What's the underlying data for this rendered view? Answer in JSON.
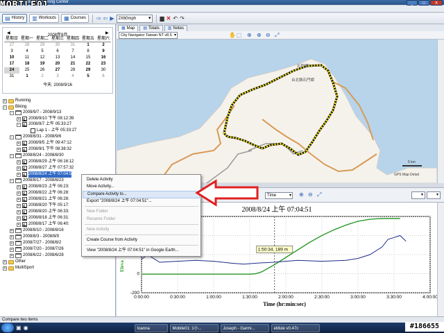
{
  "window": {
    "title": "Joseph - Garmin Training Center",
    "controls": [
      "_",
      "□",
      "X"
    ]
  },
  "watermark": {
    "brand": "MOBILE01"
  },
  "toolbar": {
    "history": "History",
    "workouts": "Workouts",
    "courses": "Courses",
    "speed": "2X60mph"
  },
  "calendar": {
    "title": "2008年8月",
    "prev": "◀",
    "next": "▶",
    "weekdays": [
      "星期日",
      "星期一",
      "星期二",
      "星期三",
      "星期四",
      "星期五",
      "星期六"
    ],
    "days": [
      [
        "27",
        "28",
        "29",
        "30",
        "31",
        "1",
        "2"
      ],
      [
        "3",
        "4",
        "5",
        "6",
        "7",
        "8",
        "9"
      ],
      [
        "10",
        "11",
        "12",
        "13",
        "14",
        "15",
        "16"
      ],
      [
        "17",
        "18",
        "19",
        "20",
        "21",
        "22",
        "23"
      ],
      [
        "24",
        "25",
        "26",
        "27",
        "28",
        "29",
        "30"
      ],
      [
        "31",
        "1",
        "2",
        "3",
        "4",
        "5",
        "6"
      ]
    ],
    "today": "今天: 2008/9/16"
  },
  "tree": {
    "running": "Running",
    "biking": "Biking",
    "w1": "2008/9/7 - 2008/9/13",
    "w1a": "2008/9/10 下午 08:12:39",
    "w1b": "2008/9/7 上午 05:33:27",
    "lap": "Lap 1 - 上午 05:33:27",
    "w2": "2008/8/31 - 2008/9/6",
    "w2a": "2008/9/5 上午 09:47:12",
    "w2b": "2008/9/1 下午 08:38:32",
    "w3": "2008/8/24 - 2008/8/30",
    "w3a": "2008/8/29 上午 06:16:12",
    "w3b": "2008/8/27 上午 07:57:32",
    "w3c": "2008/8/24 上午 07:04:5",
    "w4": "2008/8/17 - 2008/8/23",
    "w4a": "2008/8/23 上午 06:23:",
    "w4b": "2008/8/22 上午 06:28:",
    "w4c": "2008/8/21 上午 06:28:",
    "w4d": "2008/8/20 下午 05:17:",
    "w4e": "2008/8/20 上午 06:33:",
    "w4f": "2008/8/18 上午 06:31:",
    "w4g": "2008/8/17 上午 06:40:",
    "w5": "2008/8/10 - 2008/8/16",
    "w6": "2008/8/3 - 2008/8/9",
    "w7": "2008/7/27 - 2008/8/2",
    "w8": "2008/7/20 - 2008/7/26",
    "w9": "2008/6/22 - 2008/6/28",
    "other": "Other",
    "multisport": "MultiSport"
  },
  "context_menu": {
    "delete": "Delete Activity",
    "move": "Move Activity...",
    "compare": "Compare Activity to...",
    "export": "Export \"2008/8/24 上午 07:04:51\"...",
    "new_folder": "New Folder",
    "rename_folder": "Rename Folder",
    "new_activity": "New Activity",
    "create_course": "Create Course from Activity",
    "google_earth": "View \"2008/8/24 上午 07:04:51\" in Google Earth..."
  },
  "map": {
    "tabs": [
      "Map",
      "Totals",
      "Notes"
    ],
    "source": "City Navigator Taiwan NT v8.5",
    "label1": "台北縣石門鄉",
    "label2": "石門鄉",
    "scale": "5 km",
    "credit": "GPS Map Detail"
  },
  "chart_controls": {
    "xaxis_select": "Time"
  },
  "chart_data": {
    "type": "line",
    "title": "2008/8/24 上午 07:04:51",
    "xlabel": "Time (hr:min:sec)",
    "ylabel": "Eleva",
    "x_ticks": [
      "0:00:00",
      "0:30:00",
      "1:00:00",
      "1:30:00",
      "2:00:00",
      "2:30:00",
      "3:00:00",
      "3:30:00",
      "4:00:00"
    ],
    "y_ticks": [
      "600",
      "400",
      "200",
      "0",
      "-200"
    ],
    "xlim": [
      0,
      240
    ],
    "ylim": [
      -200,
      600
    ],
    "cursor": {
      "label": "1:50:34, 189 m",
      "x": 110.6,
      "y": 189
    },
    "series": [
      {
        "color": "#2a9a2a",
        "x": [
          0,
          15,
          30,
          45,
          60,
          75,
          90,
          95,
          100,
          110,
          120,
          130,
          140,
          150,
          160,
          170,
          180,
          190,
          195,
          200,
          205,
          210,
          215
        ],
        "values": [
          -5,
          -5,
          -5,
          -5,
          -5,
          -5,
          -5,
          0,
          20,
          90,
          170,
          250,
          330,
          400,
          460,
          510,
          550,
          570,
          575,
          578,
          578,
          578,
          578
        ]
      },
      {
        "color": "#1a2a88",
        "x": [
          0,
          5,
          15,
          30,
          45,
          60,
          75,
          85,
          95,
          110,
          130,
          150,
          170,
          180,
          190,
          200,
          205,
          210,
          215,
          220
        ],
        "values": [
          150,
          200,
          120,
          130,
          140,
          130,
          110,
          100,
          110,
          120,
          140,
          130,
          140,
          160,
          200,
          280,
          360,
          380,
          400,
          340
        ]
      }
    ]
  },
  "status": "Compare two items",
  "taskbar": {
    "items": [
      "Ioanna",
      "Mobile01: 1小...",
      "Joseph - Garmi...",
      "eMule v0.47c"
    ],
    "badge": "#186655"
  }
}
